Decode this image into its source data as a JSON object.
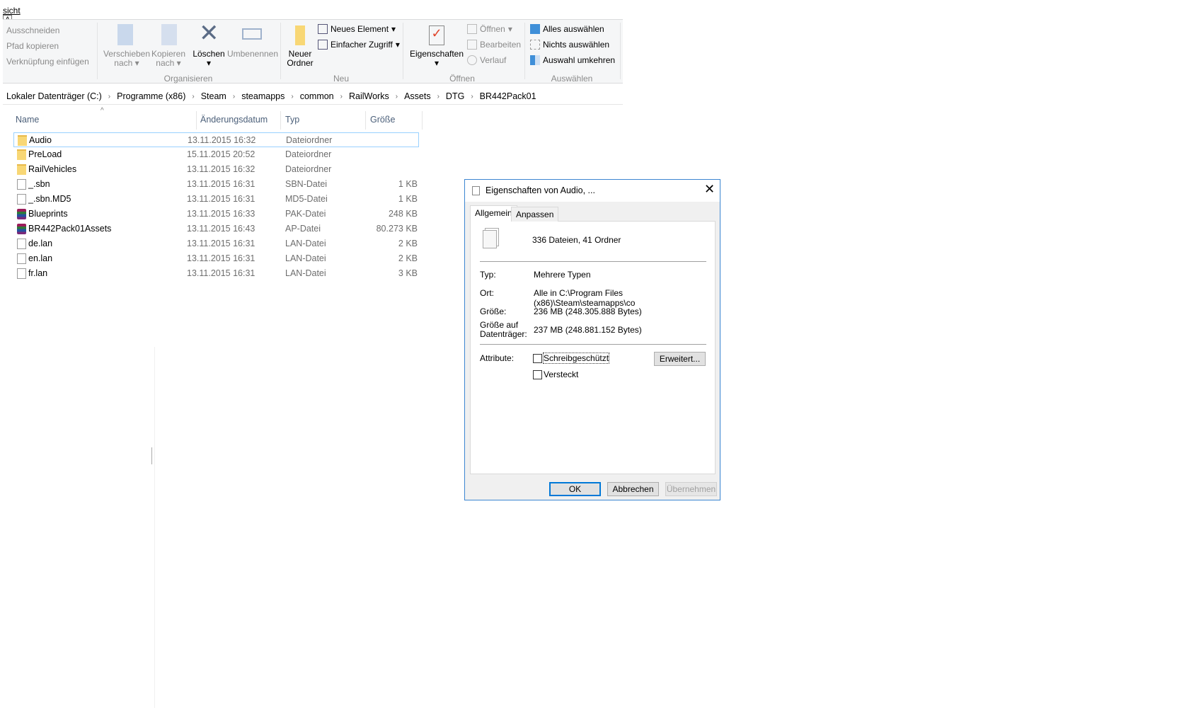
{
  "top": {
    "tab_fragment": "sicht",
    "key_tip": "A"
  },
  "ribbon": {
    "clipboard": [
      "Ausschneiden",
      "Pfad kopieren",
      "Verknüpfung einfügen"
    ],
    "organize": {
      "move": "Verschieben nach",
      "copy": "Kopieren nach",
      "delete": "Löschen",
      "rename": "Umbenennen",
      "label": "Organisieren"
    },
    "new": {
      "folder": "Neuer Ordner",
      "new_item": "Neues Element",
      "easy_access": "Einfacher Zugriff",
      "label": "Neu"
    },
    "open": {
      "properties": "Eigenschaften",
      "open": "Öffnen",
      "edit": "Bearbeiten",
      "history": "Verlauf",
      "label": "Öffnen"
    },
    "select": {
      "all": "Alles auswählen",
      "none": "Nichts auswählen",
      "invert": "Auswahl umkehren",
      "label": "Auswählen"
    }
  },
  "breadcrumb": [
    "Lokaler Datenträger (C:)",
    "Programme (x86)",
    "Steam",
    "steamapps",
    "common",
    "RailWorks",
    "Assets",
    "DTG",
    "BR442Pack01"
  ],
  "columns": [
    "Name",
    "Änderungsdatum",
    "Typ",
    "Größe"
  ],
  "files": [
    {
      "name": "Audio",
      "date": "13.11.2015 16:32",
      "type": "Dateiordner",
      "size": "",
      "icon": "folder"
    },
    {
      "name": "PreLoad",
      "date": "15.11.2015 20:52",
      "type": "Dateiordner",
      "size": "",
      "icon": "folder"
    },
    {
      "name": "RailVehicles",
      "date": "13.11.2015 16:32",
      "type": "Dateiordner",
      "size": "",
      "icon": "folder"
    },
    {
      "name": "_.sbn",
      "date": "13.11.2015 16:31",
      "type": "SBN-Datei",
      "size": "1 KB",
      "icon": "file"
    },
    {
      "name": "_.sbn.MD5",
      "date": "13.11.2015 16:31",
      "type": "MD5-Datei",
      "size": "1 KB",
      "icon": "file"
    },
    {
      "name": "Blueprints",
      "date": "13.11.2015 16:33",
      "type": "PAK-Datei",
      "size": "248 KB",
      "icon": "archive"
    },
    {
      "name": "BR442Pack01Assets",
      "date": "13.11.2015 16:43",
      "type": "AP-Datei",
      "size": "80.273 KB",
      "icon": "archive"
    },
    {
      "name": "de.lan",
      "date": "13.11.2015 16:31",
      "type": "LAN-Datei",
      "size": "2 KB",
      "icon": "file"
    },
    {
      "name": "en.lan",
      "date": "13.11.2015 16:31",
      "type": "LAN-Datei",
      "size": "2 KB",
      "icon": "file"
    },
    {
      "name": "fr.lan",
      "date": "13.11.2015 16:31",
      "type": "LAN-Datei",
      "size": "3 KB",
      "icon": "file"
    }
  ],
  "dialog": {
    "title": "Eigenschaften von Audio, ...",
    "tabs": [
      "Allgemein",
      "Anpassen"
    ],
    "summary": "336 Dateien, 41 Ordner",
    "type_label": "Typ:",
    "type_value": "Mehrere Typen",
    "location_label": "Ort:",
    "location_value": "Alle in C:\\Program Files (x86)\\Steam\\steamapps\\co",
    "size_label": "Größe:",
    "size_value": "236 MB (248.305.888 Bytes)",
    "disk_label_1": "Größe auf",
    "disk_label_2": "Datenträger:",
    "disk_value": "237 MB (248.881.152 Bytes)",
    "attributes_label": "Attribute:",
    "readonly": "Schreibgeschützt",
    "hidden": "Versteckt",
    "advanced": "Erweitert...",
    "ok": "OK",
    "cancel": "Abbrechen",
    "apply": "Übernehmen"
  }
}
